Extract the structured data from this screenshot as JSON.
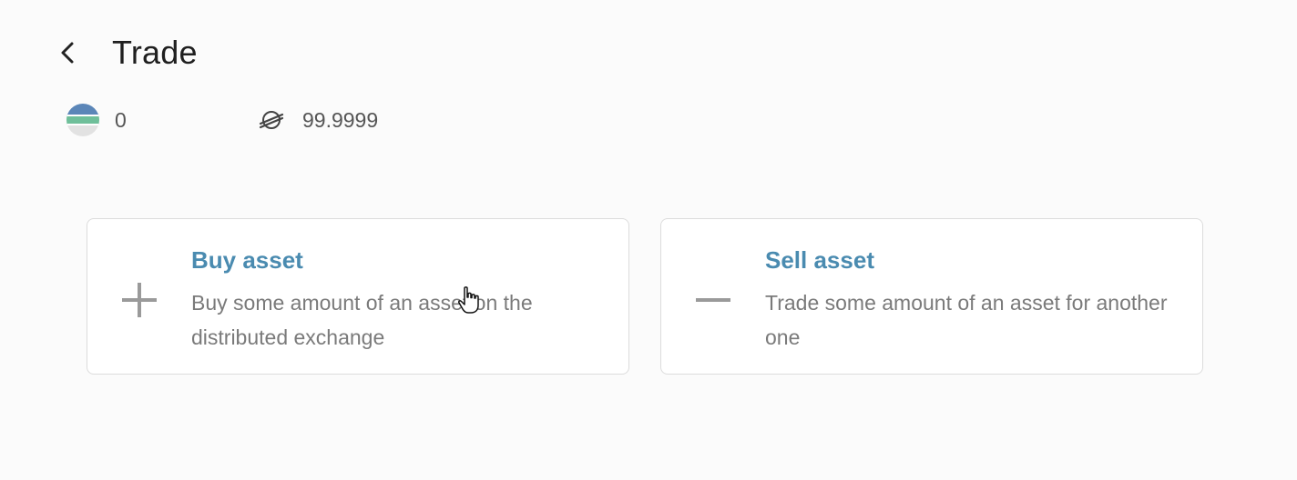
{
  "header": {
    "title": "Trade",
    "back_icon": "chevron-left-icon"
  },
  "balances": [
    {
      "icon": "asset-token-icon",
      "value": "0"
    },
    {
      "icon": "stellar-lumens-icon",
      "value": "99.9999"
    }
  ],
  "actions": [
    {
      "icon": "plus-icon",
      "title": "Buy asset",
      "description": "Buy some amount of an asset on the distributed exchange"
    },
    {
      "icon": "minus-icon",
      "title": "Sell asset",
      "description": "Trade some amount of an asset for another one"
    }
  ],
  "colors": {
    "accent": "#4a8bb0",
    "text_muted": "#7a7a7a",
    "icon_gray": "#9a9a9a"
  }
}
